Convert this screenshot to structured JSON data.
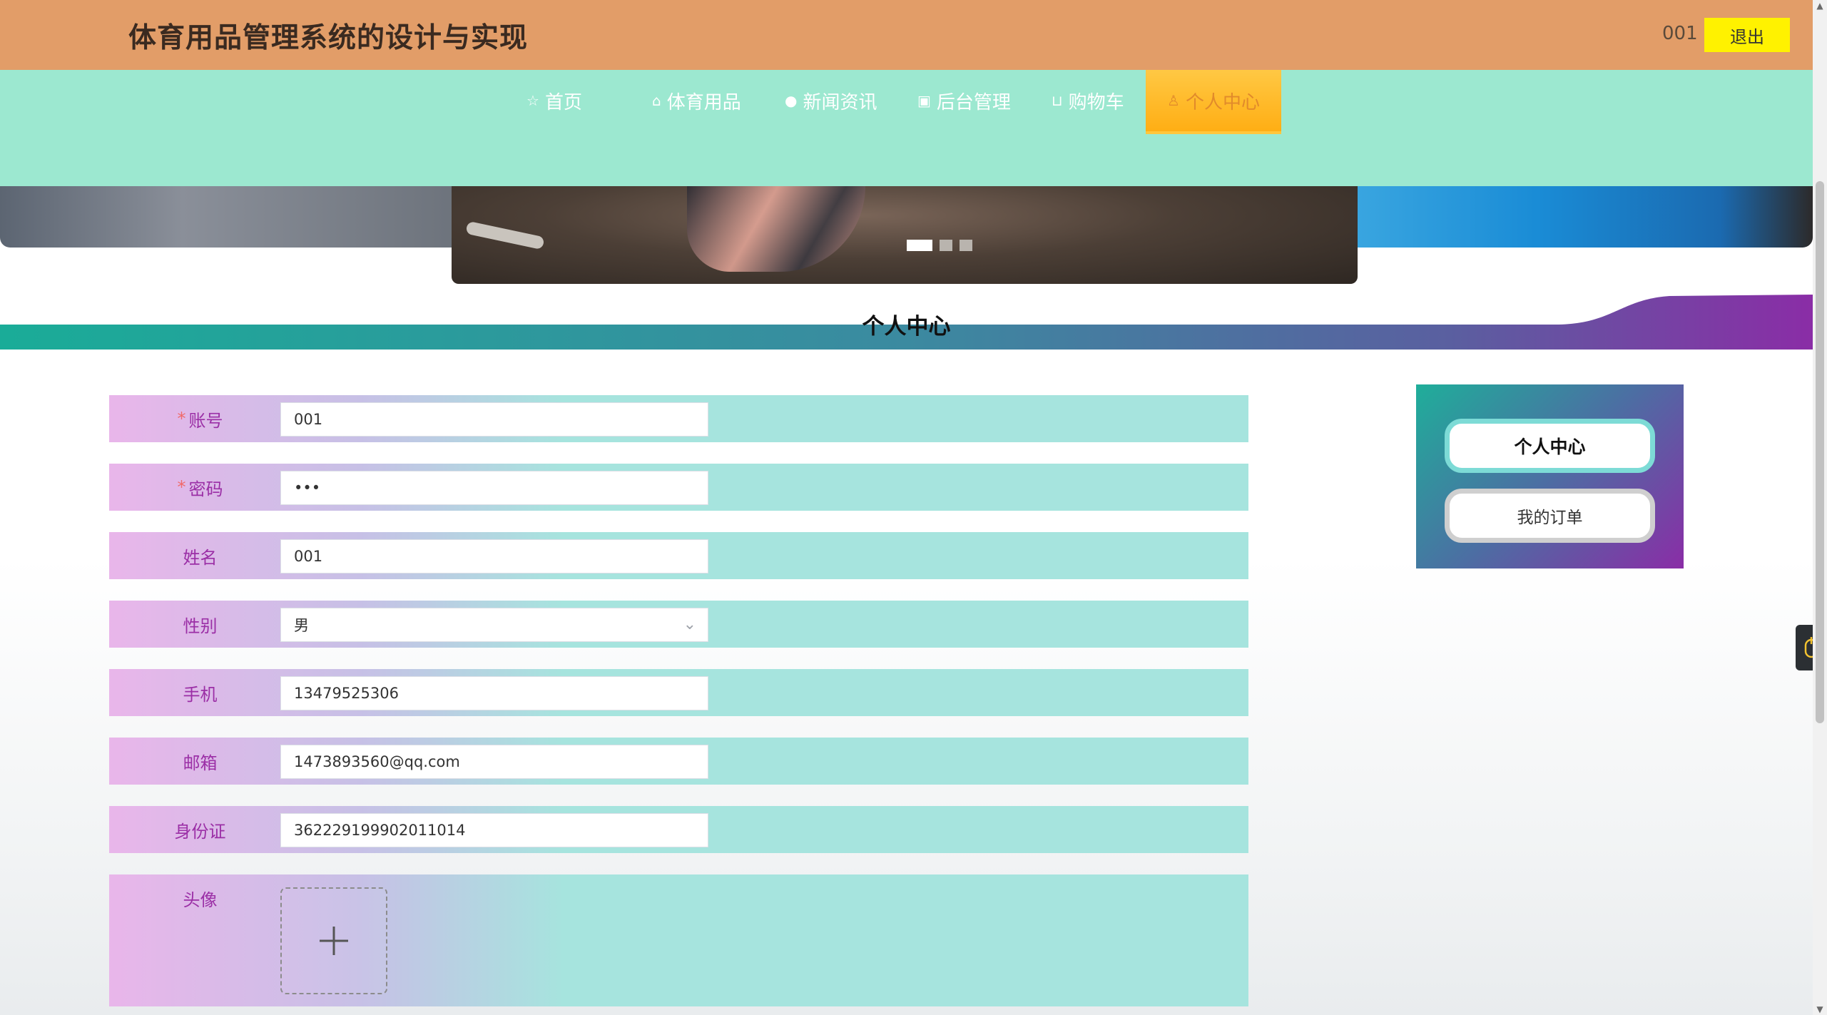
{
  "header": {
    "title": "体育用品管理系统的设计与实现",
    "username": "001",
    "logout_label": "退出"
  },
  "nav": {
    "items": [
      {
        "label": "首页",
        "icon": "star-icon"
      },
      {
        "label": "体育用品",
        "icon": "bag-icon"
      },
      {
        "label": "新闻资讯",
        "icon": "info-icon"
      },
      {
        "label": "后台管理",
        "icon": "briefcase-icon"
      },
      {
        "label": "购物车",
        "icon": "cart-icon"
      },
      {
        "label": "个人中心",
        "icon": "user-icon",
        "active": true
      }
    ]
  },
  "banner": {
    "slides_count": 3,
    "active_slide": 1
  },
  "section": {
    "title": "个人中心"
  },
  "form": {
    "fields": [
      {
        "label": "账号",
        "required": true,
        "value": "001",
        "type": "text"
      },
      {
        "label": "密码",
        "required": true,
        "value": "•••",
        "type": "password"
      },
      {
        "label": "姓名",
        "required": false,
        "value": "001",
        "type": "text"
      },
      {
        "label": "性别",
        "required": false,
        "value": "男",
        "type": "select"
      },
      {
        "label": "手机",
        "required": false,
        "value": "13479525306",
        "type": "text"
      },
      {
        "label": "邮箱",
        "required": false,
        "value": "1473893560@qq.com",
        "type": "text"
      },
      {
        "label": "身份证",
        "required": false,
        "value": "362229199902011014",
        "type": "text"
      },
      {
        "label": "头像",
        "required": false,
        "type": "upload"
      }
    ],
    "required_mark": "*"
  },
  "side_menu": {
    "items": [
      {
        "label": "个人中心",
        "active": true
      },
      {
        "label": "我的订单",
        "active": false
      }
    ]
  },
  "colors": {
    "header_bg": "#e29d68",
    "nav_bg": "#9ce8d0",
    "nav_active": "#ffb320",
    "logout_bg": "#fff200",
    "label_color": "#9b2fa6"
  }
}
